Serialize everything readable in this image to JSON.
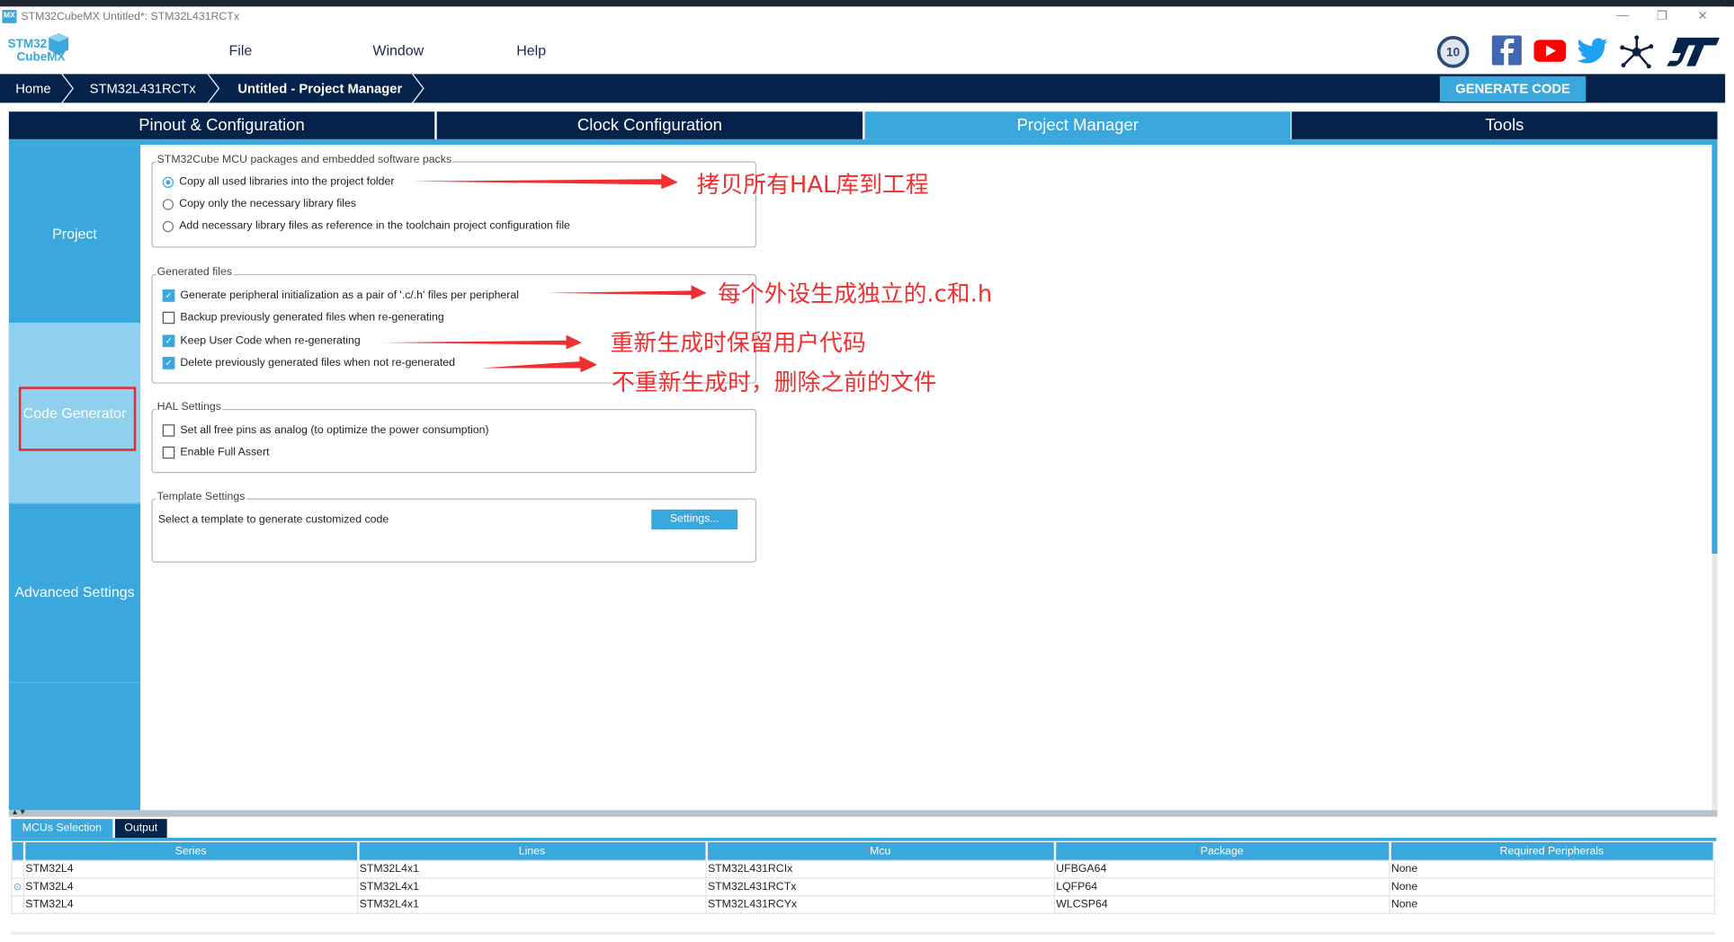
{
  "window": {
    "title": "STM32CubeMX Untitled*: STM32L431RCTx",
    "app_icon": "MX",
    "minimize": "—",
    "restore": "❐",
    "close": "✕"
  },
  "logo": {
    "line1": "STM32",
    "line2": "CubeMX"
  },
  "menu": {
    "items": [
      "File",
      "Window",
      "Help"
    ]
  },
  "social_icons": [
    "anniversary-10-years-icon",
    "facebook-icon",
    "youtube-icon",
    "twitter-icon",
    "network-icon",
    "st-logo-icon"
  ],
  "breadcrumb": [
    "Home",
    "STM32L431RCTx",
    "Untitled - Project Manager"
  ],
  "generate_code": "GENERATE CODE",
  "tabs": [
    {
      "label": "Pinout & Configuration"
    },
    {
      "label": "Clock Configuration"
    },
    {
      "label": "Project Manager",
      "active": true
    },
    {
      "label": "Tools"
    }
  ],
  "sidebar": [
    {
      "label": "Project"
    },
    {
      "label": "Code Generator",
      "active": true
    },
    {
      "label": "Advanced Settings"
    }
  ],
  "sections": {
    "packages": {
      "legend": "STM32Cube MCU packages and embedded software packs",
      "options": [
        {
          "label": "Copy all used libraries into the project folder",
          "selected": true
        },
        {
          "label": "Copy only the necessary library files",
          "selected": false
        },
        {
          "label": "Add necessary library files as reference in the toolchain project configuration file",
          "selected": false
        }
      ]
    },
    "generated": {
      "legend": "Generated files",
      "options": [
        {
          "label": "Generate peripheral initialization as a pair of '.c/.h' files per peripheral",
          "checked": true
        },
        {
          "label": "Backup previously generated files when re-generating",
          "checked": false
        },
        {
          "label": "Keep User Code when re-generating",
          "checked": true
        },
        {
          "label": "Delete previously generated files when not re-generated",
          "checked": true
        }
      ]
    },
    "hal": {
      "legend": "HAL Settings",
      "options": [
        {
          "label": "Set all free pins as analog (to optimize the power consumption)",
          "checked": false
        },
        {
          "label": "Enable Full Assert",
          "checked": false
        }
      ]
    },
    "template": {
      "legend": "Template Settings",
      "text": "Select a template to generate customized code",
      "button": "Settings..."
    }
  },
  "annotations": [
    "拷贝所有HAL库到工程",
    "每个外设生成独立的.c和.h",
    "重新生成时保留用户代码",
    "不重新生成时，删除之前的文件"
  ],
  "annotation_color": "#f03030",
  "bottom": {
    "tabs": [
      "MCUs Selection",
      "Output"
    ],
    "columns": [
      "Series",
      "Lines",
      "Mcu",
      "Package",
      "Required Peripherals"
    ],
    "rows": [
      [
        "STM32L4",
        "STM32L4x1",
        "STM32L431RCIx",
        "UFBGA64",
        "None"
      ],
      [
        "STM32L4",
        "STM32L4x1",
        "STM32L431RCTx",
        "LQFP64",
        "None"
      ],
      [
        "STM32L4",
        "STM32L4x1",
        "STM32L431RCYx",
        "WLCSP64",
        "None"
      ]
    ],
    "selected_row": 1
  },
  "colors": {
    "navy": "#04224a",
    "accent": "#3aa8dc"
  }
}
